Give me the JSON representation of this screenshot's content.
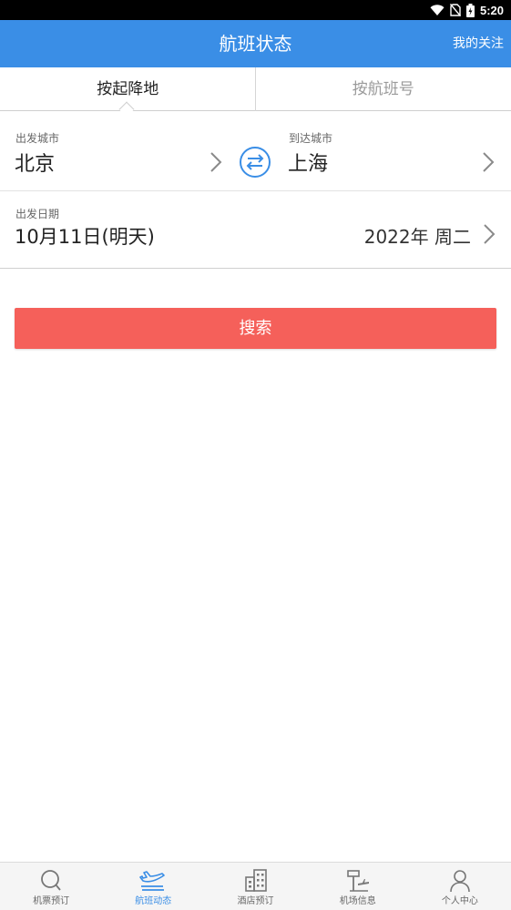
{
  "status_bar": {
    "time": "5:20",
    "icons": [
      "wifi-icon",
      "no-sim-icon",
      "battery-charging-icon"
    ]
  },
  "header": {
    "title": "航班状态",
    "follow_label": "我的关注"
  },
  "tabs": [
    {
      "label": "按起降地",
      "active": true
    },
    {
      "label": "按航班号",
      "active": false
    }
  ],
  "route": {
    "depart_label": "出发城市",
    "depart_city": "北京",
    "arrive_label": "到达城市",
    "arrive_city": "上海",
    "swap_icon": "swap-arrows-icon"
  },
  "date": {
    "label": "出发日期",
    "value": "10月11日(明天)",
    "extra": "2022年 周二"
  },
  "search": {
    "label": "搜索"
  },
  "bottom_nav": {
    "items": [
      {
        "label": "机票预订",
        "icon": "search-icon",
        "active": false
      },
      {
        "label": "航班动态",
        "icon": "airplane-icon",
        "active": true
      },
      {
        "label": "酒店预订",
        "icon": "hotel-building-icon",
        "active": false
      },
      {
        "label": "机场信息",
        "icon": "airport-tower-icon",
        "active": false
      },
      {
        "label": "个人中心",
        "icon": "user-icon",
        "active": false
      }
    ]
  },
  "colors": {
    "primary": "#3a8ee6",
    "search_button": "#f5605a",
    "status_bar": "#000000"
  }
}
